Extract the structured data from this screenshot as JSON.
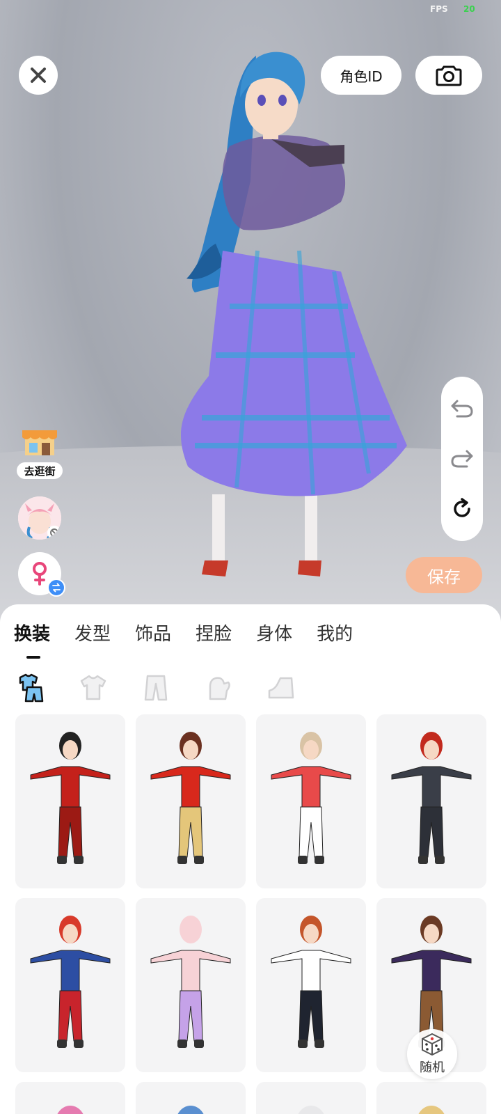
{
  "status": {
    "fps_label": "FPS",
    "fps_value": "20"
  },
  "header": {
    "role_id_label": "角色ID"
  },
  "side": {
    "shop_label": "去逛街"
  },
  "actions": {
    "save_label": "保存",
    "random_label": "随机"
  },
  "tabs": [
    {
      "label": "换装",
      "active": true
    },
    {
      "label": "发型"
    },
    {
      "label": "饰品"
    },
    {
      "label": "捏脸"
    },
    {
      "label": "身体"
    },
    {
      "label": "我的"
    }
  ],
  "subcategories": [
    "full-outfit-icon",
    "top-shirt-icon",
    "pants-icon",
    "gloves-icon",
    "shoes-icon"
  ],
  "colors": {
    "accent_save": "#f7b896",
    "swap_badge": "#3e8ef7",
    "fps_value": "#3bd14f",
    "dress": "#8c7ae8",
    "hair": "#3a8fd0"
  },
  "outfits": [
    {
      "name": "red-chinese-dress-outfit",
      "top": "#c4211b",
      "bottom": "#9c1a14",
      "hair": "#222",
      "skin": "#f6d8c4"
    },
    {
      "name": "red-beret-sweater-outfit",
      "top": "#d8281c",
      "bottom": "#e4c67a",
      "hair": "#6b3020",
      "skin": "#f6d8c4"
    },
    {
      "name": "christmas-white-red-outfit",
      "top": "#e84a4a",
      "bottom": "#ffffff",
      "hair": "#d9c3a5",
      "skin": "#f6d8c4"
    },
    {
      "name": "black-tactical-suit-outfit",
      "top": "#3a3e48",
      "bottom": "#2d3038",
      "hair": "#c22a1e",
      "skin": "#f6d8c4"
    },
    {
      "name": "captain-hero-suit-outfit",
      "top": "#2d4ea3",
      "bottom": "#c8242c",
      "hair": "#d83a2a",
      "skin": "#f6d8c4"
    },
    {
      "name": "pink-cat-costume-outfit",
      "top": "#f7d2d6",
      "bottom": "#c5a2e8",
      "hair": "#f7d2d6",
      "skin": "#f7d2d6"
    },
    {
      "name": "teal-tshirt-track-pants-outfit",
      "top": "#ffffff",
      "bottom": "#1f2430",
      "hair": "#c4552a",
      "skin": "#f6d8c4"
    },
    {
      "name": "purple-school-robe-outfit",
      "top": "#3b2a5c",
      "bottom": "#8b5a33",
      "hair": "#6b3a24",
      "skin": "#f6d8c4"
    },
    {
      "name": "pink-hair-outfit",
      "top": "#ffffff",
      "bottom": "#ffffff",
      "hair": "#e57bb0",
      "skin": "#f6d8c4"
    },
    {
      "name": "blue-hair-outfit",
      "top": "#ffffff",
      "bottom": "#ffffff",
      "hair": "#5a8fd0",
      "skin": "#f6d8c4"
    },
    {
      "name": "white-hair-outfit",
      "top": "#ffffff",
      "bottom": "#ffffff",
      "hair": "#e8e8ea",
      "skin": "#f6d8c4"
    },
    {
      "name": "blonde-hair-outfit",
      "top": "#ffffff",
      "bottom": "#ffffff",
      "hair": "#e6c77f",
      "skin": "#f6d8c4"
    }
  ]
}
